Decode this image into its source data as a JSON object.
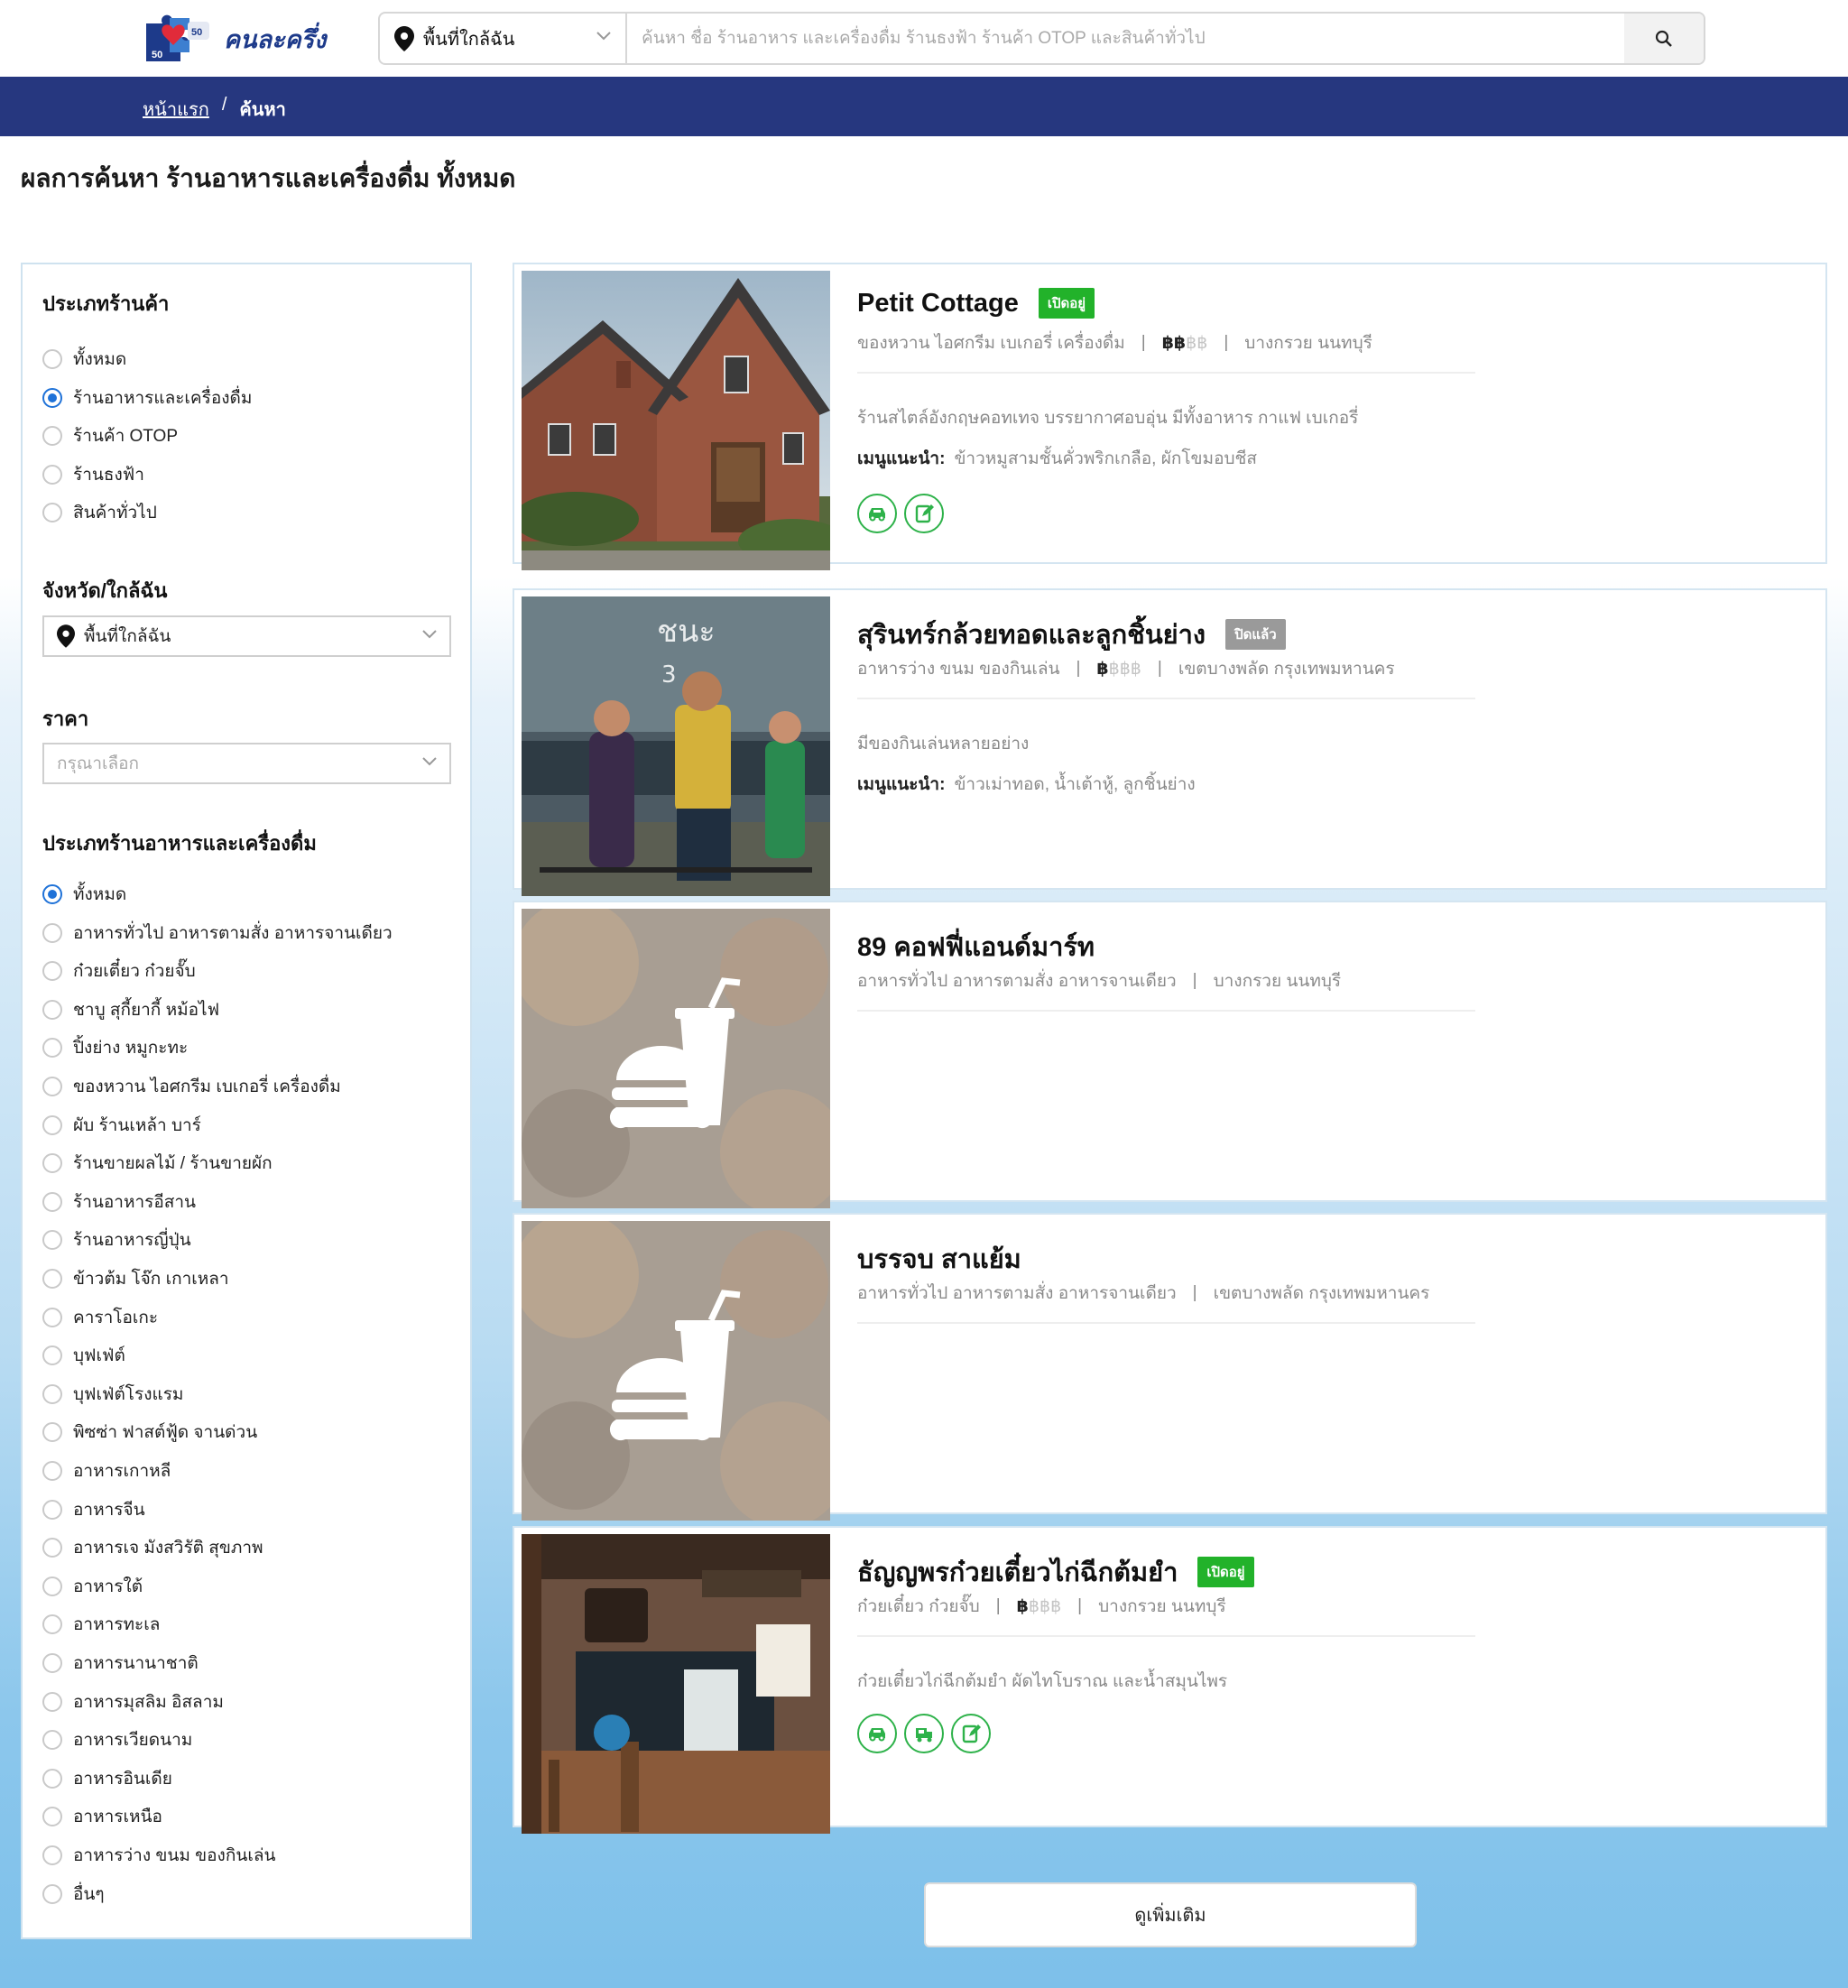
{
  "header": {
    "logo_text": "คนละครึ่ง",
    "area_select": "พื้นที่ใกล้ฉัน",
    "search_placeholder": "ค้นหา ชื่อ ร้านอาหาร และเครื่องดื่ม ร้านธงฟ้า ร้านค้า OTOP และสินค้าทั่วไป",
    "icons": {
      "location": "location-pin-icon",
      "search": "search-icon",
      "chevron": "chevron-down-icon"
    }
  },
  "breadcrumb": {
    "home": "หน้าแรก",
    "separator": "/",
    "current": "ค้นหา"
  },
  "page_title": "ผลการค้นหา ร้านอาหารและเครื่องดื่ม ทั้งหมด",
  "sidebar": {
    "shop_type": {
      "title": "ประเภทร้านค้า",
      "options": [
        "ทั้งหมด",
        "ร้านอาหารและเครื่องดื่ม",
        "ร้านค้า OTOP",
        "ร้านธงฟ้า",
        "สินค้าทั่วไป"
      ],
      "selected_index": 1
    },
    "province": {
      "title": "จังหวัด/ใกล้ฉัน",
      "value": "พื้นที่ใกล้ฉัน"
    },
    "price": {
      "title": "ราคา",
      "placeholder": "กรุณาเลือก"
    },
    "food_type": {
      "title": "ประเภทร้านอาหารและเครื่องดื่ม",
      "options": [
        "ทั้งหมด",
        "อาหารทั่วไป อาหารตามสั่ง อาหารจานเดียว",
        "ก๋วยเตี๋ยว ก๋วยจั๊บ",
        "ชาบู สุกี้ยากี้ หม้อไฟ",
        "ปิ้งย่าง หมูกะทะ",
        "ของหวาน ไอศกรีม เบเกอรี่ เครื่องดื่ม",
        "ผับ ร้านเหล้า บาร์",
        "ร้านขายผลไม้ / ร้านขายผัก",
        "ร้านอาหารอีสาน",
        "ร้านอาหารญี่ปุ่น",
        "ข้าวต้ม โจ๊ก เกาเหลา",
        "คาราโอเกะ",
        "บุฟเฟ่ต์",
        "บุฟเฟ่ต์โรงแรม",
        "พิซซ่า ฟาสต์ฟู้ด จานด่วน",
        "อาหารเกาหลี",
        "อาหารจีน",
        "อาหารเจ มังสวิรัติ สุขภาพ",
        "อาหารใต้",
        "อาหารทะเล",
        "อาหารนานาชาติ",
        "อาหารมุสลิม อิสลาม",
        "อาหารเวียดนาม",
        "อาหารอินเดีย",
        "อาหารเหนือ",
        "อาหารว่าง ขนม ของกินเล่น",
        "อื่นๆ"
      ],
      "selected_index": 0
    }
  },
  "results": [
    {
      "name": "Petit Cottage",
      "status": "เปิดอยู่",
      "status_kind": "open",
      "category": "ของหวาน ไอศกรีม เบเกอรี่ เครื่องดื่ม",
      "price_active": "฿฿",
      "price_inactive": "฿฿",
      "location": "บางกรวย นนทบุรี",
      "description": "ร้านสไตล์อังกฤษคอทเทจ บรรยากาศอบอุ่น มีทั้งอาหาร กาแฟ เบเกอรี่",
      "menu_label": "เมนูแนะนำ:",
      "menu": "ข้าวหมูสามชั้นคั่วพริกเกลือ, ผักโขมอบชีส",
      "services": [
        "car-icon",
        "edit-icon"
      ],
      "image": "brick-cottage-photo"
    },
    {
      "name": "สุรินทร์กล้วยทอดและลูกชิ้นย่าง",
      "status": "ปิดแล้ว",
      "status_kind": "closed",
      "category": "อาหารว่าง ขนม ของกินเล่น",
      "price_active": "฿",
      "price_inactive": "฿฿฿",
      "location": "เขตบางพลัด กรุงเทพมหานคร",
      "description": "มีของกินเล่นหลายอย่าง",
      "menu_label": "เมนูแนะนำ:",
      "menu": "ข้าวเม่าทอด, น้ำเต้าหู้, ลูกชิ้นย่าง",
      "services": [],
      "image": "game-characters-photo",
      "image_text": "ชนะ"
    },
    {
      "name": "89 คอฟฟี่แอนด์มาร์ท",
      "category": "อาหารทั่วไป อาหารตามสั่ง อาหารจานเดียว",
      "location": "บางกรวย นนทบุรี",
      "services": [],
      "image": "placeholder-food-icon"
    },
    {
      "name": "บรรจบ สาแย้ม",
      "category": "อาหารทั่วไป อาหารตามสั่ง อาหารจานเดียว",
      "location": "เขตบางพลัด กรุงเทพมหานคร",
      "services": [],
      "image": "placeholder-food-icon"
    },
    {
      "name": "ธัญญพรก๋วยเตี๋ยวไก่ฉีกต้มยำ",
      "status": "เปิดอยู่",
      "status_kind": "open",
      "category": "ก๋วยเตี๋ยว ก๋วยจั๊บ",
      "price_active": "฿",
      "price_inactive": "฿฿฿",
      "location": "บางกรวย นนทบุรี",
      "description": "ก๋วยเตี๋ยวไก่ฉีกต้มยำ ผัดไทโบราณ และน้ำสมุนไพร",
      "services": [
        "car-icon",
        "delivery-icon",
        "edit-icon"
      ],
      "image": "noodle-shop-photo"
    }
  ],
  "more_button": "ดูเพิ่มเติม",
  "colors": {
    "navbar": "#26377f",
    "open_badge": "#22b22a",
    "closed_badge": "#9a9a9a",
    "radio_active": "#1f72d8",
    "service_icon": "#2eb24a"
  }
}
